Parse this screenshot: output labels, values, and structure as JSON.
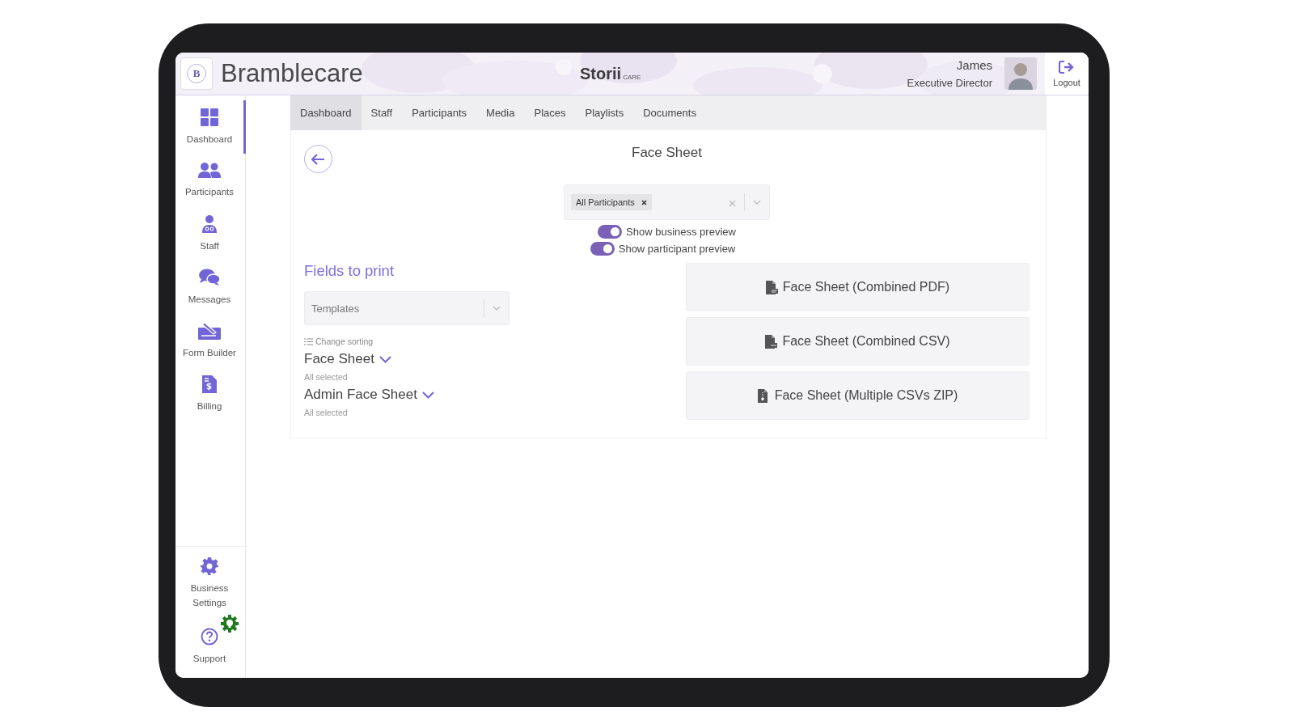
{
  "header": {
    "logo_letter": "B",
    "brand": "Bramblecare",
    "product": "Storii",
    "product_suffix": "CARE",
    "user_name": "James",
    "user_role": "Executive Director",
    "logout": "Logout"
  },
  "sidebar": {
    "items": [
      {
        "label": "Dashboard",
        "kind": "grid",
        "selected": true
      },
      {
        "label": "Participants",
        "kind": "people",
        "selected": false
      },
      {
        "label": "Staff",
        "kind": "staff",
        "selected": false
      },
      {
        "label": "Messages",
        "kind": "chat",
        "selected": false
      },
      {
        "label": "Form Builder",
        "kind": "form",
        "selected": false
      },
      {
        "label": "Billing",
        "kind": "bill",
        "selected": false
      }
    ],
    "bottom_items": [
      {
        "label": "Business Settings",
        "kind": "gear"
      },
      {
        "label": "Support",
        "kind": "help"
      }
    ]
  },
  "tabs": [
    {
      "label": "Dashboard",
      "selected": true
    },
    {
      "label": "Staff",
      "selected": false
    },
    {
      "label": "Participants",
      "selected": false
    },
    {
      "label": "Media",
      "selected": false
    },
    {
      "label": "Places",
      "selected": false
    },
    {
      "label": "Playlists",
      "selected": false
    },
    {
      "label": "Documents",
      "selected": false
    }
  ],
  "page": {
    "title": "Face Sheet",
    "participant_filter": {
      "chips": [
        "All Participants"
      ]
    },
    "toggles": [
      {
        "label": "Show business preview",
        "on": true
      },
      {
        "label": "Show participant preview",
        "on": true
      }
    ],
    "fields_heading": "Fields to print",
    "templates": {
      "placeholder": "Templates"
    },
    "change_sorting": "Change sorting",
    "sections": [
      {
        "title": "Face Sheet",
        "status": "All selected"
      },
      {
        "title": "Admin Face Sheet",
        "status": "All selected"
      }
    ],
    "exports": [
      {
        "label": "Face Sheet (Combined PDF)",
        "kind": "pdf"
      },
      {
        "label": "Face Sheet (Combined CSV)",
        "kind": "csv"
      },
      {
        "label": "Face Sheet (Multiple CSVs ZIP)",
        "kind": "zip"
      }
    ]
  }
}
